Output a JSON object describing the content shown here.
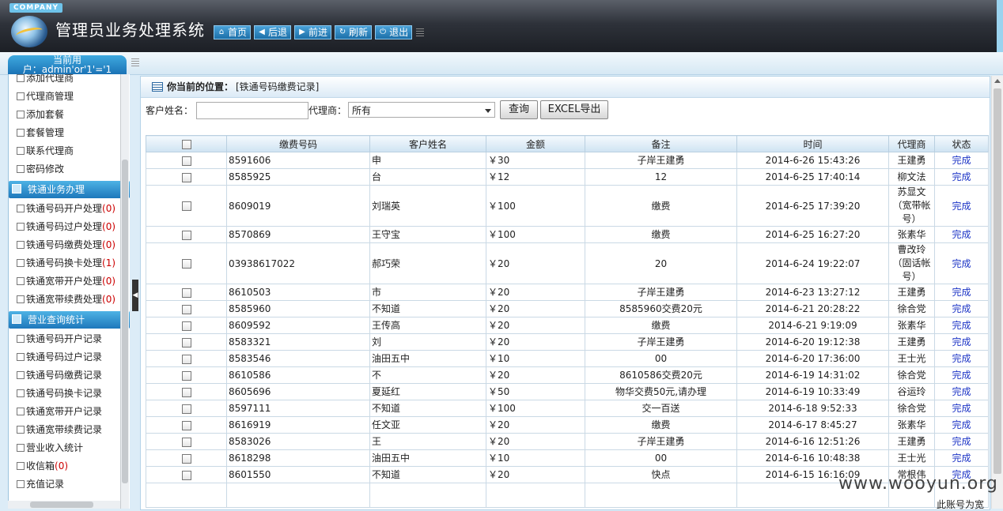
{
  "header": {
    "company": "COMPANY",
    "title": "管理员业务处理系统",
    "nav": [
      {
        "icon": "home-icon",
        "glyph": "⌂",
        "label": "首页"
      },
      {
        "icon": "back-arrow-icon",
        "glyph": "◀",
        "label": "后退"
      },
      {
        "icon": "forward-arrow-icon",
        "glyph": "▶",
        "label": "前进"
      },
      {
        "icon": "refresh-icon",
        "glyph": "↻",
        "label": "刷新"
      },
      {
        "icon": "power-icon",
        "glyph": "⏻",
        "label": "退出"
      }
    ]
  },
  "user_tab": {
    "line1": "当前用",
    "line2": "户：admin'or'1'='1"
  },
  "sidebar": {
    "top_items": [
      "添加代理商",
      "代理商管理",
      "添加套餐",
      "套餐管理",
      "联系代理商",
      "密码修改"
    ],
    "sections": [
      {
        "title": "铁通业务办理",
        "items": [
          {
            "label": "铁通号码开户处理",
            "count": "(0)"
          },
          {
            "label": "铁通号码过户处理",
            "count": "(0)"
          },
          {
            "label": "铁通号码缴费处理",
            "count": "(0)"
          },
          {
            "label": "铁通号码换卡处理",
            "count": "(1)"
          },
          {
            "label": "铁通宽带开户处理",
            "count": "(0)"
          },
          {
            "label": "铁通宽带续费处理",
            "count": "(0)"
          }
        ]
      },
      {
        "title": "营业查询统计",
        "items": [
          {
            "label": "铁通号码开户记录",
            "count": ""
          },
          {
            "label": "铁通号码过户记录",
            "count": ""
          },
          {
            "label": "铁通号码缴费记录",
            "count": ""
          },
          {
            "label": "铁通号码换卡记录",
            "count": ""
          },
          {
            "label": "铁通宽带开户记录",
            "count": ""
          },
          {
            "label": "铁通宽带续费记录",
            "count": ""
          },
          {
            "label": "营业收入统计",
            "count": ""
          },
          {
            "label": "收信箱",
            "count": "(0)"
          },
          {
            "label": "充值记录",
            "count": ""
          }
        ]
      }
    ]
  },
  "location": {
    "prefix": "你当前的位置：",
    "value": "[铁通号码缴费记录]"
  },
  "filter": {
    "name_label": "客户姓名：",
    "name_value": "",
    "agent_label": "代理商：",
    "agent_selected": "所有",
    "query_button": "查询",
    "export_button": "EXCEL导出"
  },
  "table": {
    "columns": [
      "缴费号码",
      "客户姓名",
      "金额",
      "备注",
      "时间",
      "代理商",
      "状态"
    ],
    "rows": [
      {
        "number": "8591606",
        "name": "申",
        "amount": "￥30",
        "note": "子岸王建勇",
        "time": "2014-6-26 15:43:26",
        "agent": "王建勇",
        "status": "完成"
      },
      {
        "number": "8585925",
        "name": "台",
        "amount": "￥12",
        "note": "12",
        "time": "2014-6-25 17:40:14",
        "agent": "柳文法",
        "status": "完成"
      },
      {
        "number": "8609019",
        "name": "刘瑞英",
        "amount": "￥100",
        "note": "缴费",
        "time": "2014-6-25 17:39:20",
        "agent": "苏显文（宽带帐号）",
        "status": "完成"
      },
      {
        "number": "8570869",
        "name": "王守宝",
        "amount": "￥100",
        "note": "缴费",
        "time": "2014-6-25 16:27:20",
        "agent": "张素华",
        "status": "完成"
      },
      {
        "number": "03938617022",
        "name": "郝巧荣",
        "amount": "￥20",
        "note": "20",
        "time": "2014-6-24 19:22:07",
        "agent": "曹改玲（固话帐号）",
        "status": "完成"
      },
      {
        "number": "8610503",
        "name": "市",
        "amount": "￥20",
        "note": "子岸王建勇",
        "time": "2014-6-23 13:27:12",
        "agent": "王建勇",
        "status": "完成"
      },
      {
        "number": "8585960",
        "name": "不知道",
        "amount": "￥20",
        "note": "8585960交费20元",
        "time": "2014-6-21 20:28:22",
        "agent": "徐合党",
        "status": "完成"
      },
      {
        "number": "8609592",
        "name": "王传高",
        "amount": "￥20",
        "note": "缴费",
        "time": "2014-6-21 9:19:09",
        "agent": "张素华",
        "status": "完成"
      },
      {
        "number": "8583321",
        "name": "刘",
        "amount": "￥20",
        "note": "子岸王建勇",
        "time": "2014-6-20 19:12:38",
        "agent": "王建勇",
        "status": "完成"
      },
      {
        "number": "8583546",
        "name": "油田五中",
        "amount": "￥10",
        "note": "00",
        "time": "2014-6-20 17:36:00",
        "agent": "王士光",
        "status": "完成"
      },
      {
        "number": "8610586",
        "name": "不",
        "amount": "￥20",
        "note": "8610586交费20元",
        "time": "2014-6-19 14:31:02",
        "agent": "徐合党",
        "status": "完成"
      },
      {
        "number": "8605696",
        "name": "夏延红",
        "amount": "￥50",
        "note": "物华交费50元,请办理",
        "time": "2014-6-19 10:33:49",
        "agent": "谷运玲",
        "status": "完成"
      },
      {
        "number": "8597111",
        "name": "不知道",
        "amount": "￥100",
        "note": "交一百送",
        "time": "2014-6-18 9:52:33",
        "agent": "徐合党",
        "status": "完成"
      },
      {
        "number": "8616919",
        "name": "任文亚",
        "amount": "￥20",
        "note": "缴费",
        "time": "2014-6-17 8:45:27",
        "agent": "张素华",
        "status": "完成"
      },
      {
        "number": "8583026",
        "name": "王",
        "amount": "￥20",
        "note": "子岸王建勇",
        "time": "2014-6-16 12:51:26",
        "agent": "王建勇",
        "status": "完成"
      },
      {
        "number": "8618298",
        "name": "油田五中",
        "amount": "￥10",
        "note": "00",
        "time": "2014-6-16 10:48:38",
        "agent": "王士光",
        "status": "完成"
      },
      {
        "number": "8601550",
        "name": "不知道",
        "amount": "￥20",
        "note": "快点",
        "time": "2014-6-15 16:16:09",
        "agent": "常根伟",
        "status": "完成"
      }
    ]
  },
  "footer_note": "此账号为宽",
  "watermark": "www.wooyun.org"
}
